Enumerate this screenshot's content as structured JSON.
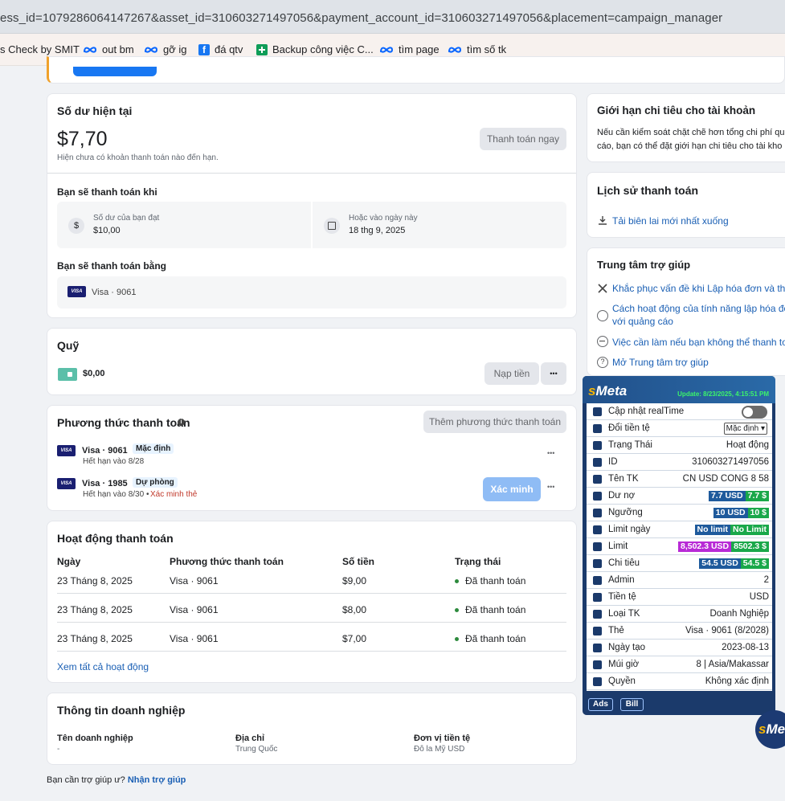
{
  "browser": {
    "url": "ess_id=1079286064147267&asset_id=310603271497056&payment_account_id=310603271497056&placement=campaign_manager",
    "bookmarks": [
      {
        "label": "s Check by SMIT",
        "icon": "none"
      },
      {
        "label": "out bm",
        "icon": "meta-icon"
      },
      {
        "label": "gỡ ig",
        "icon": "meta-icon"
      },
      {
        "label": "đá qtv",
        "icon": "facebook-icon"
      },
      {
        "label": "Backup công việc C...",
        "icon": "sheets-icon"
      },
      {
        "label": "tìm page",
        "icon": "meta-icon"
      },
      {
        "label": "tìm số tk",
        "icon": "meta-icon"
      }
    ]
  },
  "balance": {
    "title": "Số dư hiện tại",
    "amount": "$7,70",
    "note": "Hiện chưa có khoản thanh toán nào đến hạn.",
    "pay_now": "Thanh toán ngay",
    "when_title": "Bạn sẽ thanh toán khi",
    "threshold_label": "Số dư của bạn đạt",
    "threshold_value": "$10,00",
    "date_label": "Hoặc vào ngày này",
    "date_value": "18 thg 9, 2025",
    "method_title": "Bạn sẽ thanh toán bằng",
    "method_value": "Visa · 9061"
  },
  "fund": {
    "title": "Quỹ",
    "amount": "$0,00",
    "add_funds": "Nạp tiền",
    "more": "•••"
  },
  "payment_methods": {
    "title": "Phương thức thanh toán",
    "add_button": "Thêm phương thức thanh toán",
    "items": [
      {
        "name": "Visa · 9061",
        "badge": "Mặc định",
        "expiry": "Hết hạn vào 8/28",
        "verify": ""
      },
      {
        "name": "Visa · 1985",
        "badge": "Dự phòng",
        "expiry": "Hết hạn vào 8/30 •",
        "verify": "Xác minh thẻ"
      }
    ],
    "verify_button": "Xác minh"
  },
  "activity": {
    "title": "Hoạt động thanh toán",
    "headers": [
      "Ngày",
      "Phương thức thanh toán",
      "Số tiền",
      "Trạng thái"
    ],
    "rows": [
      {
        "date": "23 Tháng 8, 2025",
        "method": "Visa · 9061",
        "amount": "$9,00",
        "status": "Đã thanh toán"
      },
      {
        "date": "23 Tháng 8, 2025",
        "method": "Visa · 9061",
        "amount": "$8,00",
        "status": "Đã thanh toán"
      },
      {
        "date": "23 Tháng 8, 2025",
        "method": "Visa · 9061",
        "amount": "$7,00",
        "status": "Đã thanh toán"
      }
    ],
    "see_all": "Xem tất cả hoạt động"
  },
  "business": {
    "title": "Thông tin doanh nghiệp",
    "name_label": "Tên doanh nghiệp",
    "name_value": "-",
    "address_label": "Địa chỉ",
    "address_value": "Trung Quốc",
    "currency_label": "Đơn vị tiền tệ",
    "currency_value": "Đô la Mỹ USD"
  },
  "help_footer": {
    "question": "Bạn cần trợ giúp ư?",
    "link": "Nhận trợ giúp"
  },
  "spend_limit": {
    "title": "Giới hạn chi tiêu cho tài khoản",
    "text_line1": "Nếu cần kiểm soát chặt chẽ hơn tổng chi phí qu",
    "text_line2": "cáo, bạn có thể đặt giới hạn chi tiêu cho tài kho"
  },
  "history": {
    "title": "Lịch sử thanh toán",
    "download": "Tải biên lai mới nhất xuống"
  },
  "help_center": {
    "title": "Trung tâm trợ giúp",
    "items": [
      {
        "line1": "Khắc phục vấn đề khi Lập hóa đơn và thanh",
        "line2": ""
      },
      {
        "line1": "Cách hoạt động của tính năng lập hóa đơn c",
        "line2": "với quảng cáo"
      },
      {
        "line1": "Việc cần làm nếu bạn không thể thanh toán",
        "line2": ""
      },
      {
        "line1": "Mở Trung tâm trợ giúp",
        "line2": ""
      }
    ]
  },
  "smeta": {
    "logo_s": "s",
    "logo_rest": "Meta",
    "update": "Update: 8/23/2025, 4:15:51 PM",
    "rows": [
      {
        "label": "Cập nhật realTime",
        "value": "",
        "type": "toggle"
      },
      {
        "label": "Đổi tiền tệ",
        "value": "Mặc định",
        "type": "select"
      },
      {
        "label": "Trạng Thái",
        "value": "Hoạt động",
        "type": "text"
      },
      {
        "label": "ID",
        "value": "310603271497056",
        "type": "text"
      },
      {
        "label": "Tên TK",
        "value": "CN USD CONG 8 58",
        "type": "text"
      },
      {
        "label": "Dư nợ",
        "pill1": "7.7 USD",
        "pill2": "7.7 $",
        "type": "pills",
        "color1": "#1e5a9c"
      },
      {
        "label": "Ngưỡng",
        "pill1": "10 USD",
        "pill2": "10 $",
        "type": "pills",
        "color1": "#1e5a9c"
      },
      {
        "label": "Limit ngày",
        "pill1": "No limit",
        "pill2": "No Limit",
        "type": "pills",
        "color1": "#1e5a9c"
      },
      {
        "label": "Limit",
        "pill1": "8,502.3 USD",
        "pill2": "8502.3 $",
        "type": "pills",
        "color1": "#b82ad6"
      },
      {
        "label": "Chi tiêu",
        "pill1": "54.5 USD",
        "pill2": "54.5 $",
        "type": "pills",
        "color1": "#1e5a9c"
      },
      {
        "label": "Admin",
        "value": "2",
        "type": "text"
      },
      {
        "label": "Tiền tệ",
        "value": "USD",
        "type": "text"
      },
      {
        "label": "Loại TK",
        "value": "Doanh Nghiệp",
        "type": "text"
      },
      {
        "label": "Thẻ",
        "value": "Visa · 9061 (8/2028)",
        "type": "text"
      },
      {
        "label": "Ngày tạo",
        "value": "2023-08-13",
        "type": "text"
      },
      {
        "label": "Múi giờ",
        "value": "8 | Asia/Makassar",
        "type": "text"
      },
      {
        "label": "Quyền",
        "value": "Không xác định",
        "type": "text"
      }
    ],
    "ads_button": "Ads",
    "bill_button": "Bill"
  }
}
